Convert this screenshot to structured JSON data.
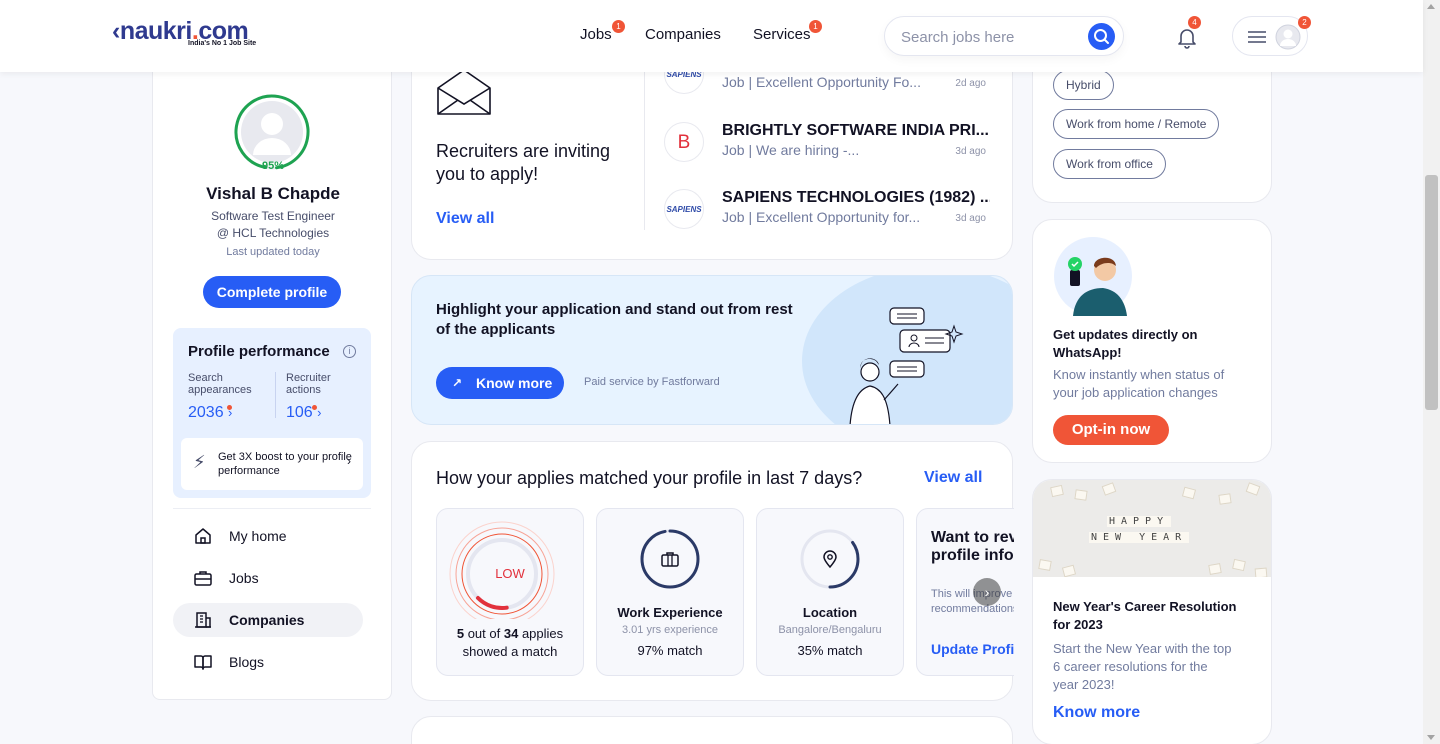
{
  "header": {
    "logo_text": "naukri.com",
    "logo_tagline": "India's No 1 Job Site",
    "nav": [
      {
        "label": "Jobs",
        "badge": "1"
      },
      {
        "label": "Companies"
      },
      {
        "label": "Services",
        "badge": "1"
      }
    ],
    "search_placeholder": "Search jobs here",
    "notification_count": "4",
    "menu_badge": "2"
  },
  "profile": {
    "completion": "95%",
    "name": "Vishal B Chapde",
    "role": "Software Test Engineer",
    "company": "@ HCL Technologies",
    "updated": "Last updated today",
    "complete_button": "Complete profile",
    "performance": {
      "title": "Profile performance",
      "info": "i",
      "search_label": "Search appearances",
      "search_value": "2036",
      "recruiter_label": "Recruiter actions",
      "recruiter_value": "106",
      "boost_text": "Get 3X boost to your profile performance"
    }
  },
  "sidebar": {
    "items": [
      {
        "label": "My home",
        "icon": "home-icon",
        "active": false
      },
      {
        "label": "Jobs",
        "icon": "briefcase-icon",
        "active": false
      },
      {
        "label": "Companies",
        "icon": "building-icon",
        "active": true
      },
      {
        "label": "Blogs",
        "icon": "book-icon",
        "active": false
      }
    ]
  },
  "recruiters": {
    "title": "Recruiters are inviting you to apply!",
    "view_all": "View all",
    "jobs": [
      {
        "logo": "SAPIENS",
        "company": "",
        "desc": "Job | Excellent Opportunity Fo...",
        "time": "2d ago"
      },
      {
        "logo": "B",
        "company": "BRIGHTLY SOFTWARE INDIA PRI...",
        "desc": "Job | We are hiring -...",
        "time": "3d ago"
      },
      {
        "logo": "SAPIENS",
        "company": "SAPIENS TECHNOLOGIES (1982) ...",
        "desc": "Job | Excellent Opportunity for...",
        "time": "3d ago"
      }
    ]
  },
  "highlight": {
    "title": "Highlight your application and stand out from rest of the applicants",
    "button": "Know more",
    "paid": "Paid service by Fastforward"
  },
  "match": {
    "title": "How your applies matched your profile in last 7 days?",
    "view_all": "View all",
    "low_label": "LOW",
    "matched": "5",
    "matched_text": "out of",
    "total": "34",
    "total_text": "applies",
    "caption_2": "showed a match",
    "tiles": [
      {
        "title": "Work Experience",
        "sub": "3.01 yrs experience",
        "value": "97% match",
        "icon": "briefcase-icon",
        "percent": 97
      },
      {
        "title": "Location",
        "sub": "Bangalore/Bengaluru",
        "value": "35% match",
        "icon": "location-pin-icon",
        "percent": 35
      }
    ],
    "want_title": "Want to review your profile information?",
    "want_sub": "This will improve your job recommendations",
    "want_link": "Update Profile",
    "low_ratio": 0.147
  },
  "preferences": {
    "chips": [
      "Hybrid",
      "Work from home / Remote",
      "Work from office"
    ]
  },
  "whatsapp": {
    "title": "Get updates directly on WhatsApp!",
    "sub": "Know instantly when status of your job application changes",
    "button": "Opt-in now"
  },
  "newyear": {
    "image_text_1": "HAPPY",
    "image_text_2": "NEW YEAR",
    "title": "New Year's Career Resolution for 2023",
    "sub": "Start the New Year with the top 6 career resolutions for the year 2023!",
    "link": "Know more"
  },
  "colors": {
    "primary": "#275df5",
    "accent": "#f05537",
    "success": "#1ea351",
    "text": "#121224",
    "muted": "#717b9e"
  }
}
